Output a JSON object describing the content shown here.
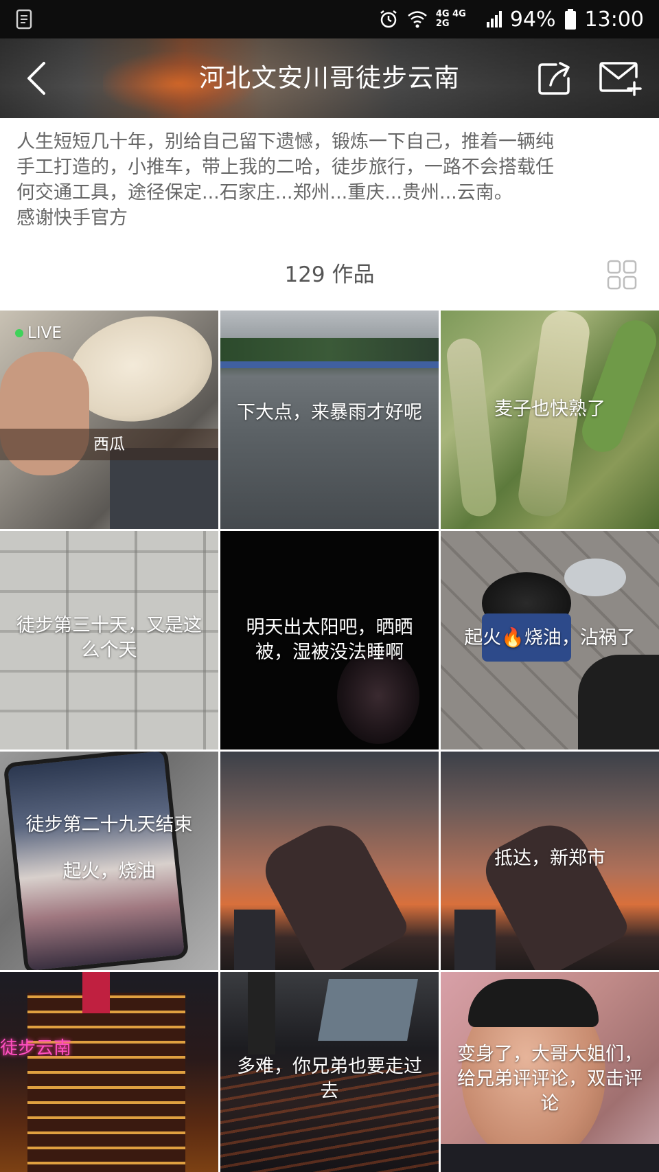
{
  "status_bar": {
    "network_label": "4G 4G 2G",
    "battery": "94%",
    "time": "13:00"
  },
  "header": {
    "title": "河北文安川哥徒步云南",
    "back_icon": "chevron-left-icon",
    "share_icon": "share-icon",
    "message_icon": "mail-plus-icon"
  },
  "profile": {
    "bio_lines": [
      "人生短短几十年，别给自己留下遗憾，锻炼一下自己，推着一辆纯",
      "手工打造的，小推车，带上我的二哈，徒步旅行，一路不会搭载任",
      "何交通工具，途径保定...石家庄...郑州...重庆...贵州...云南。",
      "感谢快手官方"
    ],
    "works_count": "129 作品"
  },
  "works": [
    {
      "caption": "西瓜",
      "live": "LIVE"
    },
    {
      "caption": "下大点，来暴雨才好呢"
    },
    {
      "caption": "麦子也快熟了"
    },
    {
      "caption": "徒步第三十天，又是这么个天"
    },
    {
      "caption": "明天出太阳吧，晒晒被，湿被没法睡啊"
    },
    {
      "caption": "起火🔥烧油，沾祸了"
    },
    {
      "caption": "徒步第二十九天结束",
      "caption2": "起火，烧油"
    },
    {
      "caption": ""
    },
    {
      "caption": "抵达，新郑市"
    },
    {
      "caption": "",
      "sign": "徒步云南"
    },
    {
      "caption": "多难，你兄弟也要走过去"
    },
    {
      "caption": "变身了，大哥大姐们，给兄弟评评论，双击评论"
    }
  ]
}
